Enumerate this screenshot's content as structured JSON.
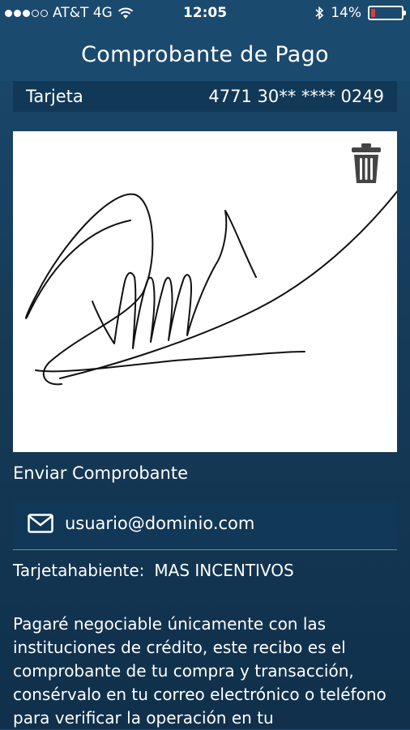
{
  "status_bar": {
    "carrier": "AT&T 4G",
    "time": "12:05",
    "battery_percent_text": "14%",
    "battery_level": 0.14,
    "signal_dots_filled": 3,
    "signal_dots_total": 5,
    "icons": [
      "wifi-icon",
      "bluetooth-icon",
      "battery-icon"
    ]
  },
  "header": {
    "title": "Comprobante de Pago"
  },
  "card": {
    "label": "Tarjeta",
    "number": "4771 30** **** 0249"
  },
  "signature": {
    "delete_icon": "trash-icon"
  },
  "send_receipt": {
    "label": "Enviar Comprobante",
    "email_icon": "envelope-icon",
    "email_value": "usuario@dominio.com"
  },
  "cardholder": {
    "label": "Tarjetahabiente:",
    "value": "MAS INCENTIVOS"
  },
  "disclaimer": "Pagaré negociable únicamente con las instituciones de crédito, este recibo es el comprobante de tu compra y transacción, consérvalo en tu correo electrónico o teléfono para verificar la operación en tu",
  "colors": {
    "header_bg": "#1b4a6f",
    "row_bg": "#123858",
    "battery_low": "#e23a3a",
    "text": "#ffffff"
  }
}
